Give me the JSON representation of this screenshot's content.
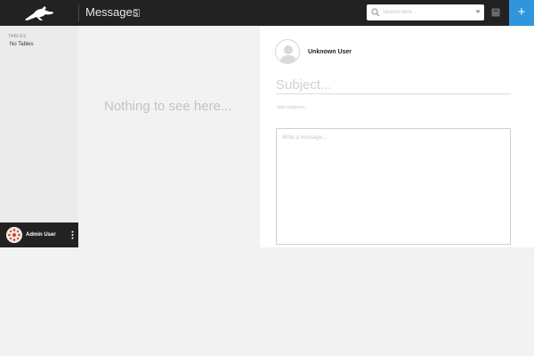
{
  "header": {
    "title": "Messages",
    "search": {
      "placeholder": "Search here...",
      "value": ""
    },
    "add_label": "+",
    "icons": [
      "logo-icon",
      "bookmark-icon",
      "search-icon",
      "chevron-down-icon",
      "archive-icon",
      "plus-icon"
    ]
  },
  "sidebar": {
    "section_label": "TABLES",
    "empty_label": "No Tables",
    "user": {
      "name": "Admin User"
    }
  },
  "list": {
    "empty_message": "Nothing to see here..."
  },
  "compose": {
    "recipient_name": "Unknown User",
    "subject_placeholder": "Subject...",
    "attachments_label": "Add recipients...",
    "message_placeholder": "Write a message..."
  },
  "colors": {
    "topbar": "#222222",
    "accent": "#2f95dc",
    "sidebar": "#ebebeb"
  }
}
